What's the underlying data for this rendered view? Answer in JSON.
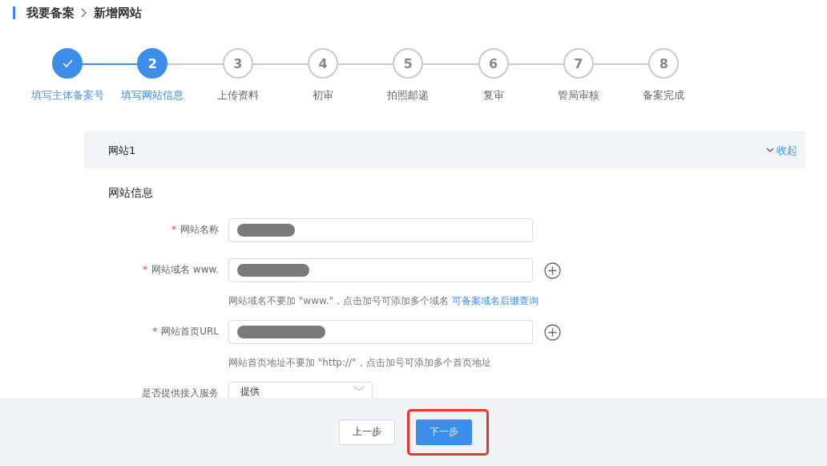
{
  "breadcrumb": [
    "我要备案",
    "新增网站"
  ],
  "steps": [
    {
      "label": "填写主体备案号",
      "done": true,
      "selected": false
    },
    {
      "number": "2",
      "label": "填写网站信息",
      "done": false,
      "selected": true
    },
    {
      "number": "3",
      "label": "上传资料",
      "done": false,
      "selected": false
    },
    {
      "number": "4",
      "label": "初审",
      "done": false,
      "selected": false
    },
    {
      "number": "5",
      "label": "拍照邮递",
      "done": false,
      "selected": false
    },
    {
      "number": "6",
      "label": "复审",
      "done": false,
      "selected": false
    },
    {
      "number": "7",
      "label": "管局审核",
      "done": false,
      "selected": false
    },
    {
      "number": "8",
      "label": "备案完成",
      "done": false,
      "selected": false
    }
  ],
  "panel": {
    "title": "网站1",
    "collapse_link": "收起",
    "expanded": true,
    "section_title": "网站信息",
    "fields": [
      {
        "kind": "input",
        "required_mark": "*",
        "label": "网站名称",
        "redacted": true,
        "addable": false
      },
      {
        "kind": "input",
        "required_mark": "*",
        "label": "网站域名 www.",
        "redacted": true,
        "addable": true,
        "hint": "网站域名不要加 \"www.\"，点击加号可添加多个域名",
        "hint_link": "可备案域名后缀查询"
      },
      {
        "kind": "input",
        "required_mark": "*",
        "label": "网站首页URL",
        "redacted": true,
        "addable": true,
        "hint": "网站首页地址不要加 \"http://\"，点击加号可添加多个首页地址"
      },
      {
        "kind": "select",
        "label": "是否提供接入服务",
        "value": "提供"
      }
    ]
  },
  "footer": {
    "buttons": [
      {
        "label": "上一步",
        "primary": false,
        "highlighted": false
      },
      {
        "label": "下一步",
        "primary": true,
        "highlighted": true
      }
    ]
  }
}
